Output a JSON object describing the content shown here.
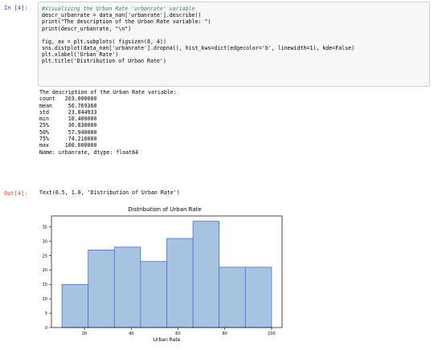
{
  "in_cell": {
    "prompt": "In [4]:",
    "lines": [
      "#Visualizing the Urban Rate 'urbanrate' variable",
      "descr_urbanrate = data_nan['urbanrate'].describe()",
      "print(\"The description of the Urban Rate variable: \")",
      "print(descr_urbanrate, \"\\n\")",
      "fig, ax = plt.subplots( figsize=(8, 4))",
      "sns.distplot(data_nan['urbanrate'].dropna(), hist_kws=dict(edgecolor='b', linewidth=1), kde=False)",
      "plt.xlabel('Urban Rate')",
      "plt.title('Distribution of Urban Rate')"
    ]
  },
  "stdout": {
    "header": "The description of the Urban Rate variable:",
    "stats": [
      {
        "label": "count",
        "value": "203.000000"
      },
      {
        "label": "mean",
        "value": "56.769360"
      },
      {
        "label": "std",
        "value": "23.844933"
      },
      {
        "label": "min",
        "value": "10.400000"
      },
      {
        "label": "25%",
        "value": "36.830000"
      },
      {
        "label": "50%",
        "value": "57.940000"
      },
      {
        "label": "75%",
        "value": "74.210000"
      },
      {
        "label": "max",
        "value": "100.000000"
      }
    ],
    "footer": "Name: urbanrate, dtype: float64"
  },
  "out_cell": {
    "prompt": "Out[4]:",
    "text": "Text(0.5, 1.0, 'Distribution of Urban Rate')"
  },
  "chart_data": {
    "type": "bar",
    "title": "Distribution of Urban Rate",
    "xlabel": "Urban Rate",
    "ylabel": "",
    "bins": [
      {
        "start": 10.4,
        "end": 21.6,
        "count": 15
      },
      {
        "start": 21.6,
        "end": 32.8,
        "count": 27
      },
      {
        "start": 32.8,
        "end": 44.0,
        "count": 28
      },
      {
        "start": 44.0,
        "end": 55.2,
        "count": 23
      },
      {
        "start": 55.2,
        "end": 66.4,
        "count": 31
      },
      {
        "start": 66.4,
        "end": 77.6,
        "count": 37
      },
      {
        "start": 77.6,
        "end": 88.8,
        "count": 21
      },
      {
        "start": 88.8,
        "end": 100.0,
        "count": 21
      }
    ],
    "xticks": [
      "20",
      "40",
      "60",
      "80",
      "100"
    ],
    "yticks": [
      "0",
      "5",
      "10",
      "15",
      "20",
      "25",
      "30",
      "35"
    ],
    "xlim": [
      5.9,
      104.5
    ],
    "ylim": [
      0,
      38.85
    ],
    "grid": false,
    "bar_color": "#a6c4e0",
    "edge_color": "#4a6fd8"
  }
}
